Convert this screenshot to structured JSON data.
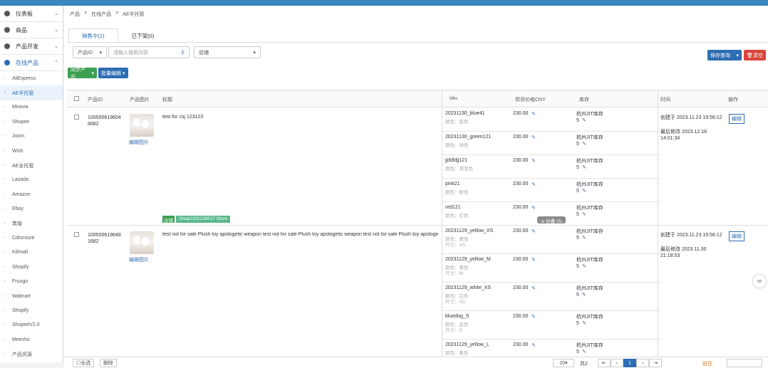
{
  "sidebar": {
    "groups": [
      {
        "label": "仪表板",
        "icon": "gear-icon"
      },
      {
        "label": "商品",
        "icon": "gear-icon"
      },
      {
        "label": "产品开发",
        "icon": "box-icon"
      },
      {
        "label": "在线产品",
        "icon": "globe-icon"
      }
    ],
    "items": [
      "AliExpress",
      "AE半托管",
      "Miravia",
      "Shopee",
      "Joom",
      "Wish",
      "AE全托管",
      "Lazada",
      "Amazon",
      "Ebay",
      "敦煌",
      "Cdiscount",
      "Kilimall",
      "Shopify",
      "Fruugo",
      "Walmart",
      "Shopify",
      "ShopeeV2.0",
      "Meesho",
      "产品货源"
    ]
  },
  "breadcrumb": [
    "产品",
    "在线产品",
    "AE半托管"
  ],
  "tabs": [
    {
      "label": "销售中(2)"
    },
    {
      "label": "已下架(0)"
    }
  ],
  "filters": {
    "field_select": "产品ID",
    "search_placeholder": "请输入搜索内容",
    "store_select": "店铺"
  },
  "buttons": {
    "sync": "同步产品",
    "batch": "批量编辑",
    "save_search": "保存查询",
    "clear": "清空"
  },
  "columns": {
    "product_id": "产品ID",
    "image": "产品图片",
    "title": "标题",
    "sku": "sku",
    "price": "供货价格CNY",
    "stock": "库存",
    "time": "时间",
    "action": "操作"
  },
  "products": [
    {
      "id": "1005006196046082",
      "img_link": "编辑图片",
      "title": "test for csj 123123",
      "store_badge": "店铺",
      "store_name": "Shop1102126517 Store",
      "expand": "折叠 (5)",
      "time1": "创建于 2023.11.23 19:56:12",
      "time2": "最后修改 2023.12.18 14:01:34",
      "action": "编辑",
      "skus": [
        {
          "name": "20231130_blue41",
          "sub1": "颜色：蓝色",
          "sub2": "",
          "price": "230.00",
          "wh": "杭州JIT库存",
          "qty": "5"
        },
        {
          "name": "20231130_green121",
          "sub1": "颜色：绿色",
          "sub2": "",
          "price": "230.00",
          "wh": "杭州JIT库存",
          "qty": "5"
        },
        {
          "name": "jjddldjj121",
          "sub1": "颜色：渐变色",
          "sub2": "",
          "price": "230.00",
          "wh": "杭州JIT库存",
          "qty": "5"
        },
        {
          "name": "pink21",
          "sub1": "颜色：粉色",
          "sub2": "",
          "price": "230.00",
          "wh": "杭州JIT库存",
          "qty": "5"
        },
        {
          "name": "red121",
          "sub1": "颜色：红色",
          "sub2": "",
          "price": "230.00",
          "wh": "杭州JIT库存",
          "qty": "5"
        }
      ]
    },
    {
      "id": "1005006196481682",
      "img_link": "编辑图片",
      "title": "test not for sale Plush toy apologetic weapon test not for sale Plush toy apologetic weapon test not for sale Plush toy apologe",
      "time1": "创建于 2023.11.23 19:56:12",
      "time2": "最后修改 2023.11.30 21:18:53",
      "action": "编辑",
      "skus": [
        {
          "name": "20231129_yellow_XS",
          "sub1": "颜色：黄色",
          "sub2": "尺寸：XS",
          "price": "230.00",
          "wh": "杭州JIT库存",
          "qty": "5"
        },
        {
          "name": "20231129_yellow_M",
          "sub1": "颜色：黄色",
          "sub2": "尺寸：M",
          "price": "230.00",
          "wh": "杭州JIT库存",
          "qty": "5"
        },
        {
          "name": "20231129_white_XS",
          "sub1": "颜色：白色",
          "sub2": "尺寸：XS",
          "price": "230.00",
          "wh": "杭州JIT库存",
          "qty": "5"
        },
        {
          "name": "bluedog_S",
          "sub1": "颜色：蓝色",
          "sub2": "尺寸：S",
          "price": "230.00",
          "wh": "杭州JIT库存",
          "qty": "5"
        },
        {
          "name": "20231129_yellow_L",
          "sub1": "颜色：黄色",
          "sub2": "",
          "price": "230.00",
          "wh": "杭州JIT库存",
          "qty": "5"
        }
      ]
    }
  ],
  "bottom": {
    "select_all": "全选",
    "delete": "删除",
    "page_size": "20",
    "total": "共2",
    "page": "1",
    "goto": "前往"
  },
  "colors": {
    "primary": "#2d6db3",
    "green": "#3c9f52",
    "red": "#d9453a",
    "topbar": "#3a86c0"
  }
}
